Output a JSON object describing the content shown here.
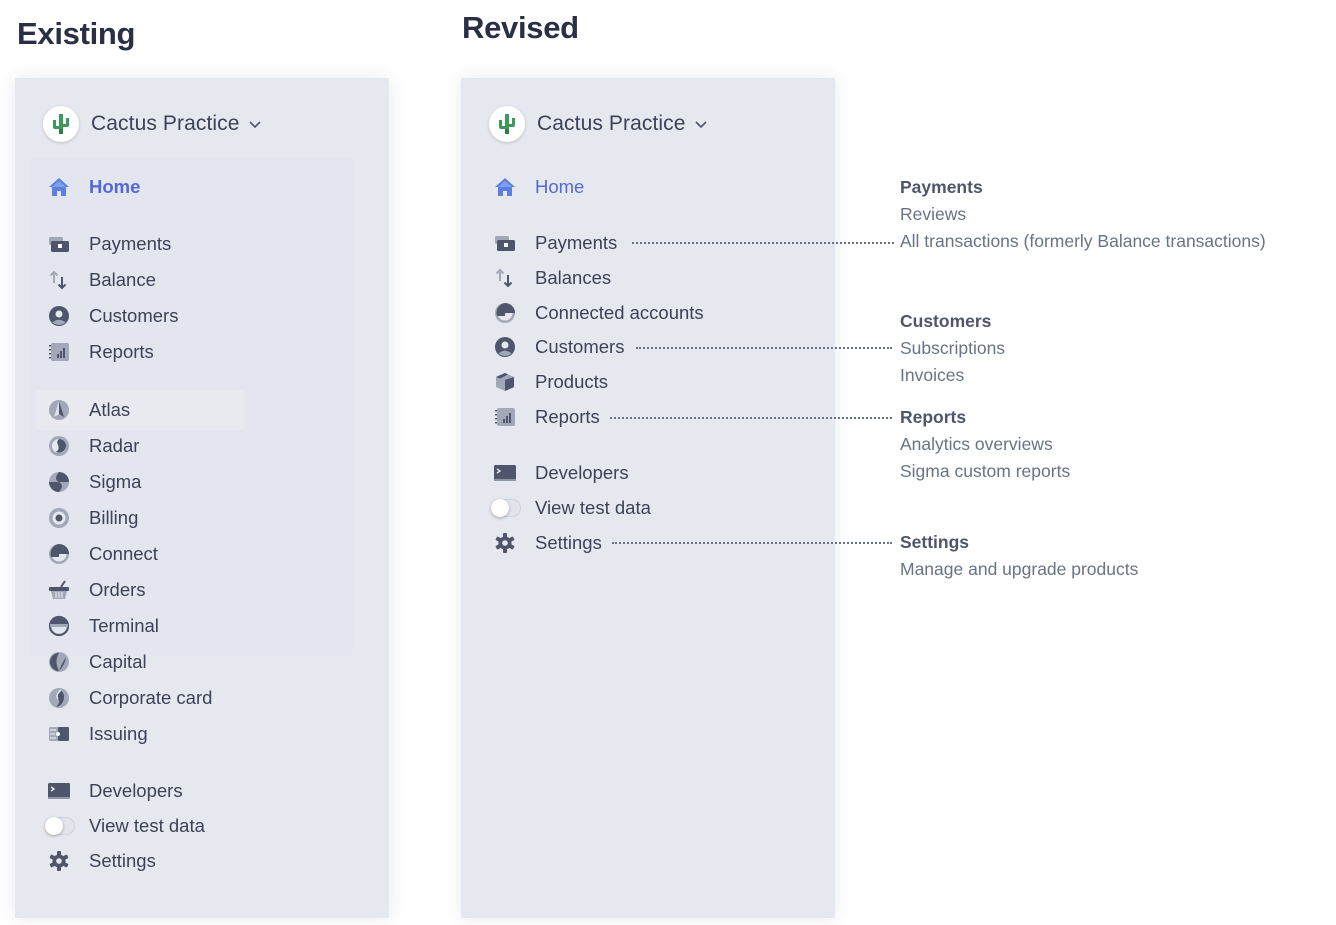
{
  "existing": {
    "heading": "Existing",
    "account": {
      "name": "Cactus Practice",
      "icon": "cactus-icon"
    },
    "nav": [
      {
        "label": "Home",
        "icon": "home-icon",
        "active": true
      },
      {
        "label": "Payments",
        "icon": "payments-icon"
      },
      {
        "label": "Balance",
        "icon": "balance-arrows-icon"
      },
      {
        "label": "Customers",
        "icon": "customer-icon"
      },
      {
        "label": "Reports",
        "icon": "reports-icon"
      },
      {
        "label": "Atlas",
        "icon": "atlas-icon"
      },
      {
        "label": "Radar",
        "icon": "radar-icon"
      },
      {
        "label": "Sigma",
        "icon": "sigma-icon"
      },
      {
        "label": "Billing",
        "icon": "billing-icon"
      },
      {
        "label": "Connect",
        "icon": "connect-icon"
      },
      {
        "label": "Orders",
        "icon": "orders-basket-icon"
      },
      {
        "label": "Terminal",
        "icon": "terminal-icon"
      },
      {
        "label": "Capital",
        "icon": "capital-icon"
      },
      {
        "label": "Corporate card",
        "icon": "corporate-card-icon"
      },
      {
        "label": "Issuing",
        "icon": "issuing-icon"
      },
      {
        "label": "Developers",
        "icon": "developers-icon"
      },
      {
        "label": "View test data",
        "icon": "toggle-switch",
        "toggle": true,
        "value": false
      },
      {
        "label": "Settings",
        "icon": "gear-icon"
      }
    ]
  },
  "revised": {
    "heading": "Revised",
    "account": {
      "name": "Cactus Practice",
      "icon": "cactus-icon"
    },
    "nav": [
      {
        "label": "Home",
        "icon": "home-icon",
        "active": true
      },
      {
        "label": "Payments",
        "icon": "payments-icon"
      },
      {
        "label": "Balances",
        "icon": "balance-arrows-icon"
      },
      {
        "label": "Connected accounts",
        "icon": "connect-icon"
      },
      {
        "label": "Customers",
        "icon": "customer-icon"
      },
      {
        "label": "Products",
        "icon": "products-box-icon"
      },
      {
        "label": "Reports",
        "icon": "reports-icon"
      },
      {
        "label": "Developers",
        "icon": "developers-icon"
      },
      {
        "label": "View test data",
        "icon": "toggle-switch",
        "toggle": true,
        "value": false
      },
      {
        "label": "Settings",
        "icon": "gear-icon"
      }
    ],
    "details": [
      {
        "title": "Payments",
        "items": [
          "Reviews",
          "All transactions (formerly Balance transactions)"
        ]
      },
      {
        "title": "Customers",
        "items": [
          "Subscriptions",
          "Invoices"
        ]
      },
      {
        "title": "Reports",
        "items": [
          "Analytics overviews",
          "Sigma custom reports"
        ]
      },
      {
        "title": "Settings",
        "items": [
          "Manage and upgrade products"
        ]
      }
    ]
  },
  "colors": {
    "panel_bg": "#e6e8ef",
    "active": "#5469d4",
    "text": "#3c4257",
    "icon": "#4f566b",
    "cactus": "#3d9a5c"
  }
}
